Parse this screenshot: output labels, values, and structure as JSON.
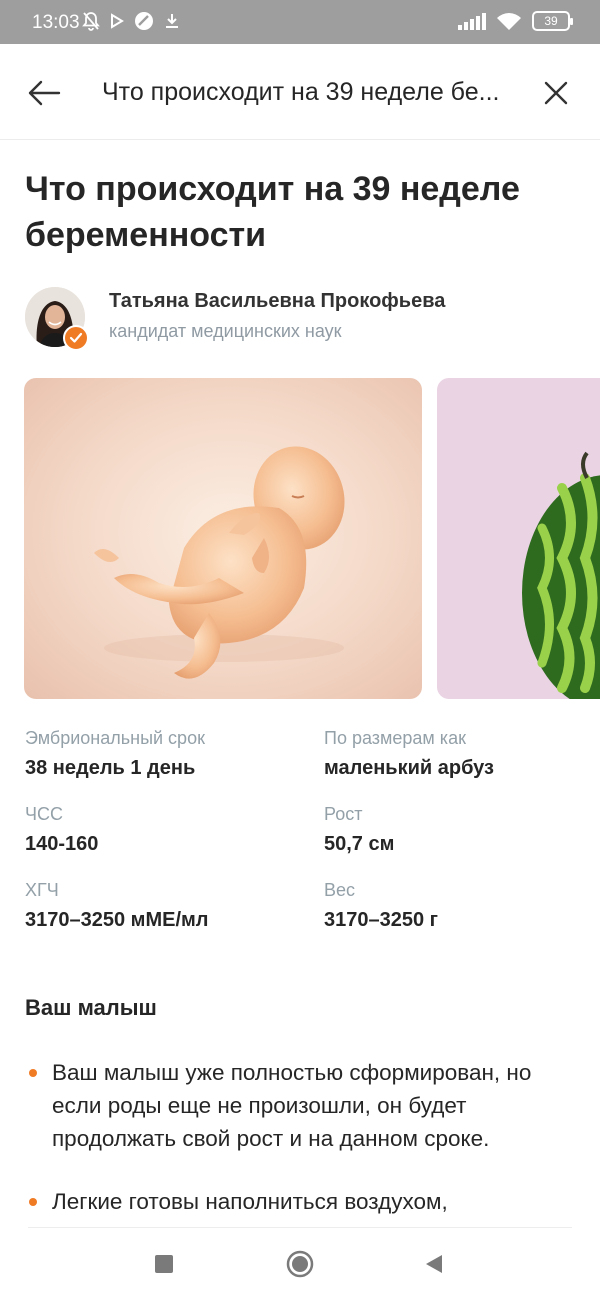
{
  "status_bar": {
    "time": "13:03",
    "battery": "39",
    "icons": [
      "bell-off-icon",
      "play-icon",
      "no-disturb-icon",
      "download-icon",
      "signal-icon",
      "wifi-icon",
      "battery-icon"
    ]
  },
  "app_bar": {
    "title": "Что происходит на 39 неделе бе...",
    "back_icon": "arrow-left-icon",
    "close_icon": "close-icon"
  },
  "article": {
    "title": "Что происходит на 39 неделе беременности",
    "author": {
      "name": "Татьяна Васильевна Прокофьева",
      "degree": "кандидат медицинских наук",
      "badge_icon": "check-icon"
    },
    "gallery": {
      "slides": [
        "fetus-illustration",
        "watermelon-illustration"
      ]
    },
    "facts": [
      {
        "label": "Эмбриональный срок",
        "value": "38 недель 1 день"
      },
      {
        "label": "По размерам как",
        "value": "маленький арбуз"
      },
      {
        "label": "ЧСС",
        "value": "140-160"
      },
      {
        "label": "Рост",
        "value": "50,7 см"
      },
      {
        "label": "ХГЧ",
        "value": "3170–3250 мМЕ/мл"
      },
      {
        "label": "Вес",
        "value": "3170–3250 г"
      }
    ],
    "section": {
      "heading": "Ваш малыш",
      "bullets": [
        "Ваш малыш уже полностью сформирован, но если роды еще не произошли, он будет продолжать свой рост и на данном сроке.",
        "Легкие готовы наполниться воздухом,"
      ]
    }
  },
  "nav_bar": {
    "icons": [
      "square-icon",
      "home-circle-icon",
      "back-triangle-icon"
    ]
  },
  "colors": {
    "accent": "#f07b25",
    "status_bar": "#9e9e9e",
    "muted_text": "#93a0a8",
    "slide_1_bg": "#f4d8c7",
    "slide_2_bg": "#ead3e3"
  }
}
